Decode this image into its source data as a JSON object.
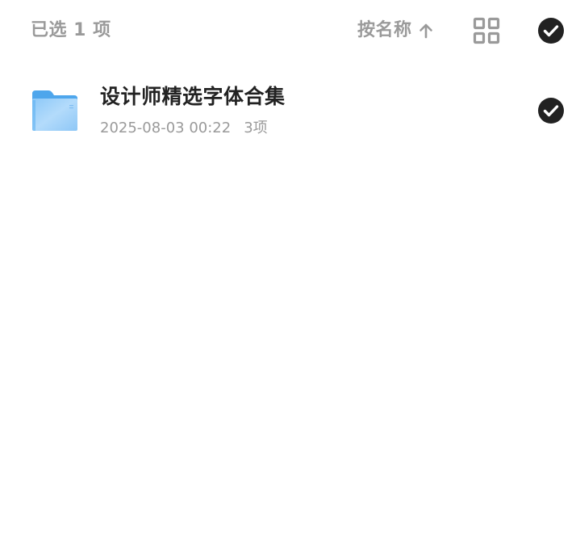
{
  "header": {
    "selected_label": "已选 1 项",
    "sort_label": "按名称",
    "sort_direction_icon": "arrow-up-icon",
    "view_toggle_icon": "grid-view-icon",
    "select_all_icon": "check-circle-icon"
  },
  "files": [
    {
      "name": "设计师精选字体合集",
      "date": "2025-08-03 00:22",
      "count": "3项",
      "icon": "folder-icon",
      "selected": true
    }
  ],
  "colors": {
    "muted_text": "#9a9a9a",
    "primary_text": "#222222",
    "check_fill": "#222222",
    "folder_blue": "#5aaef0"
  }
}
